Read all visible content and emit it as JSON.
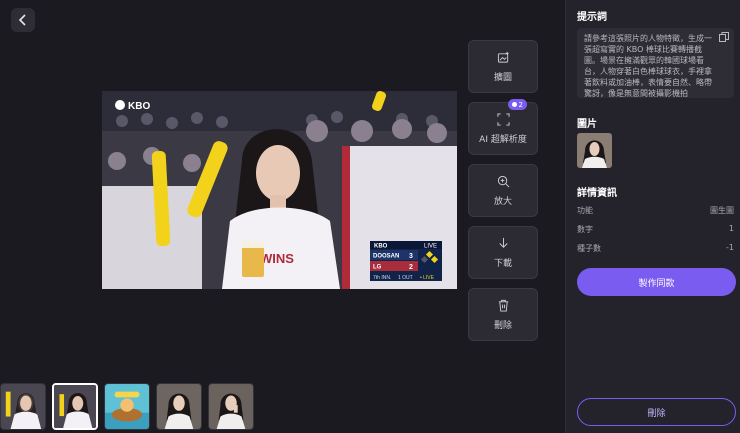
{
  "nav": {
    "back_icon": "chevron-left-icon"
  },
  "main_image": {
    "kbo_logo": "KBO",
    "scoreboard": {
      "league": "KBO",
      "live": "LIVE",
      "teams": [
        {
          "name": "DOOSAN",
          "score": "3"
        },
        {
          "name": "LG",
          "score": "2"
        }
      ],
      "inning": "7th INN.",
      "outs": "1 OUT",
      "live_footer": "• LIVE"
    }
  },
  "tools": [
    {
      "label": "擴圖",
      "icon": "expand-image-icon"
    },
    {
      "label": "AI 超解析度",
      "icon": "upscale-icon",
      "badge": "2"
    },
    {
      "label": "放大",
      "icon": "zoom-in-icon"
    },
    {
      "label": "下載",
      "icon": "download-icon"
    },
    {
      "label": "刪除",
      "icon": "trash-icon"
    }
  ],
  "panel": {
    "prompt_title": "提示詞",
    "prompt_text": "請參考這張照片的人物特徵，生成一張超寫實的 KBO 棒球比賽轉播截圖。場景在擁滿觀眾的韓國球場看台，人物穿著白色棒球球衣，手裡拿著飲料或加油棒，表情要自然、略帶驚訝，像是無意間被攝影機拍",
    "image_title": "圖片",
    "details_title": "詳情資訊",
    "details": [
      {
        "label": "功能",
        "value": "圖生圖"
      },
      {
        "label": "數字",
        "value": "1"
      },
      {
        "label": "種子數",
        "value": "-1"
      }
    ],
    "make_same_label": "製作同款",
    "delete_label": "刪除"
  },
  "colors": {
    "accent": "#7b5cf0",
    "background": "#1b1a20",
    "panel": "#24232b"
  }
}
